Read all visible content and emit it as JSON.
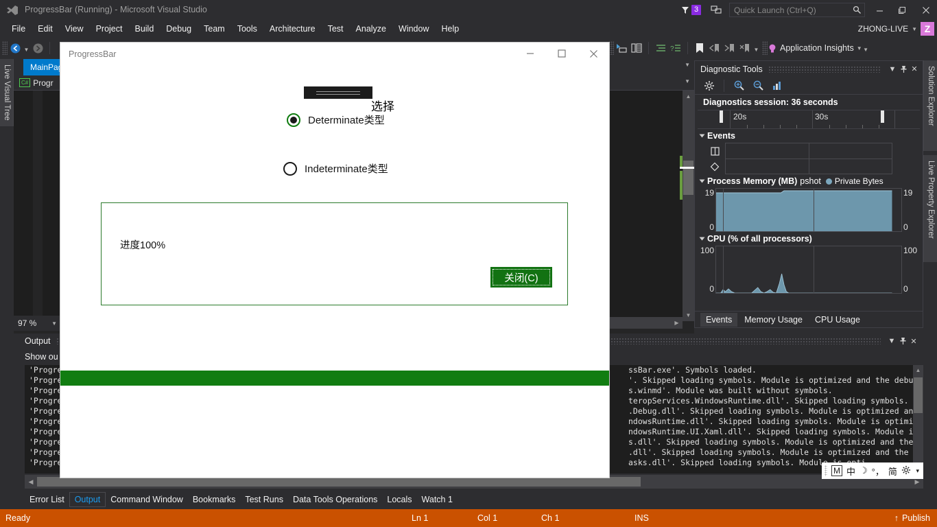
{
  "titlebar": {
    "app_title": "ProgressBar (Running) - Microsoft Visual Studio",
    "notification_count": "3",
    "quick_launch_placeholder": "Quick Launch (Ctrl+Q)",
    "user_name": "ZHONG-LIVE",
    "user_initial": "Z",
    "minimize": "—",
    "maximize": "❐",
    "close": "✕"
  },
  "menubar": {
    "items": [
      "File",
      "Edit",
      "View",
      "Project",
      "Build",
      "Debug",
      "Team",
      "Tools",
      "Architecture",
      "Test",
      "Analyze",
      "Window",
      "Help"
    ]
  },
  "toolbar": {
    "app_insights_label": "Application Insights",
    "icons": [
      "navigate-back-icon",
      "navigate-forward-icon",
      "breakpoint-disable-icon",
      "step-into-icon",
      "step-over-icon",
      "indent-icon",
      "comment-icon",
      "bookmark-icon",
      "bookmark-prev-icon",
      "bookmark-next-icon",
      "bookmark-clear-icon",
      "lightbulb-icon"
    ]
  },
  "left_dock": {
    "tab_label": "Live Visual Tree"
  },
  "right_dock": {
    "tabs": [
      "Solution Explorer",
      "Live Property Explorer"
    ]
  },
  "editor": {
    "active_tab": "MainPag",
    "nav_item": "Progr",
    "cs_badge": "C#",
    "zoom_level": "97 %"
  },
  "diagnostics": {
    "panel_title": "Diagnostic Tools",
    "session_label": "Diagnostics session: 36 seconds",
    "timeline_ticks": [
      "20s",
      "30s"
    ],
    "events_section": "Events",
    "memory_section": "Process Memory (MB)",
    "memory_overlap_text": "pshot",
    "memory_legend": "Private Bytes",
    "memory_axis_top": "19",
    "memory_axis_bottom": "0",
    "cpu_section": "CPU (% of all processors)",
    "cpu_axis_top": "100",
    "cpu_axis_bottom": "0",
    "tabs": [
      "Events",
      "Memory Usage",
      "CPU Usage"
    ],
    "active_tab": "Events",
    "toolbar_icons": [
      "gear-icon",
      "zoom-in-icon",
      "zoom-out-icon",
      "chart-icon"
    ],
    "header_buttons": [
      "chevron-down-icon",
      "pin-icon",
      "close-icon"
    ]
  },
  "output": {
    "panel_title": "Output",
    "toolbar_label": "Show ou",
    "lines": [
      "'Progre",
      "'Progre",
      "'Progre",
      "'Progre",
      "'Progre",
      "'Progre",
      "'Progre",
      "'Progre",
      "'Progre",
      "'Progre"
    ],
    "right_lines": [
      "ssBar.exe'. Symbols loaded.",
      "'. Skipped loading symbols. Module is optimized and the debugger option",
      "s.winmd'. Module was built without symbols.",
      "teropServices.WindowsRuntime.dll'. Skipped loading symbols. Module is op",
      ".Debug.dll'. Skipped loading symbols. Module is optimized and the debug",
      "ndowsRuntime.dll'. Skipped loading symbols. Module is optimized and the",
      "ndowsRuntime.UI.Xaml.dll'. Skipped loading symbols. Module is optimized",
      "s.dll'. Skipped loading symbols. Module is optimized and the debugger op",
      ".dll'. Skipped loading symbols. Module is optimized and the debugger op",
      "asks.dll'. Skipped loading symbols. Module is opti"
    ]
  },
  "bottom_tabs": {
    "items": [
      "Error List",
      "Output",
      "Command Window",
      "Bookmarks",
      "Test Runs",
      "Data Tools Operations",
      "Locals",
      "Watch 1"
    ],
    "active": "Output"
  },
  "statusbar": {
    "status": "Ready",
    "line": "Ln 1",
    "col": "Col 1",
    "ch": "Ch 1",
    "ins": "INS",
    "publish": "Publish",
    "accent_color": "#ca5100"
  },
  "app_window": {
    "title": "ProgressBar",
    "minimize": "—",
    "maximize": "☐",
    "close": "✕",
    "select_label": "选择",
    "radio_determinate": "Determinate类型",
    "radio_indeterminate": "Indeterminate类型",
    "selected_radio": "determinate"
  },
  "content_dialog": {
    "message": "进度100%",
    "close_button": "关闭(C)",
    "border_color": "#2a7a2a",
    "button_color": "#127212"
  },
  "progress_bar": {
    "value": "100",
    "color": "#117d11"
  },
  "ime_tray": {
    "items": [
      "M",
      "中",
      "☽",
      "°，",
      "简",
      "gear-icon"
    ]
  }
}
